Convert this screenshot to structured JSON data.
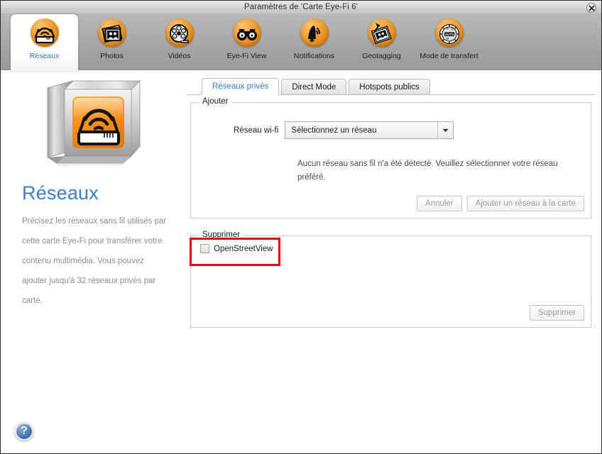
{
  "window": {
    "title": "Paramètres de 'Carte Eye-Fi 6'",
    "close_label": "×"
  },
  "toolbar": {
    "items": [
      {
        "label": "Réseaux",
        "icon": "wifi-router-icon",
        "selected": true
      },
      {
        "label": "Photos",
        "icon": "photos-stack-icon",
        "selected": false
      },
      {
        "label": "Vidéos",
        "icon": "film-reel-icon",
        "selected": false
      },
      {
        "label": "Eye-Fi View",
        "icon": "binoculars-icon",
        "selected": false
      },
      {
        "label": "Notifications",
        "icon": "bell-icon",
        "selected": false
      },
      {
        "label": "Geotagging",
        "icon": "pinned-photo-icon",
        "selected": false
      },
      {
        "label": "Mode de transfert",
        "icon": "mode-dial-icon",
        "selected": false
      }
    ]
  },
  "sidebar": {
    "icon": "wifi-router-3d-icon",
    "heading": "Réseaux",
    "description": "Précisez les réseaux sans fil utilisés par cette carte Eye-Fi pour transférer votre contenu multimédia. Vous pouvez ajouter jusqu'à 32 réseaux privés par carte."
  },
  "tabs": [
    {
      "label": "Réseaux privés",
      "active": true
    },
    {
      "label": "Direct Mode",
      "active": false
    },
    {
      "label": "Hotspots publics",
      "active": false
    }
  ],
  "add_group": {
    "legend": "Ajouter",
    "field_label": "Réseau wi-fi",
    "combo_value": "Sélectionnez un réseau",
    "combo_arrow_icon": "chevron-down-icon",
    "hint": "Aucun réseau sans fil n'a été détecté. Veuillez sélectionner votre réseau préféré.",
    "cancel_label": "Annuler",
    "add_label": "Ajouter un réseau à la carte"
  },
  "remove_group": {
    "legend": "Supprimer",
    "networks": [
      {
        "name": "OpenStreetView",
        "checked": false
      }
    ],
    "remove_label": "Supprimer"
  },
  "help": {
    "glyph": "?"
  },
  "colors": {
    "accent_blue": "#3a7fc4",
    "brand_orange": "#e88f1e",
    "annotation_red": "#e30613",
    "toolbar_grey": "#a6a6a6"
  }
}
